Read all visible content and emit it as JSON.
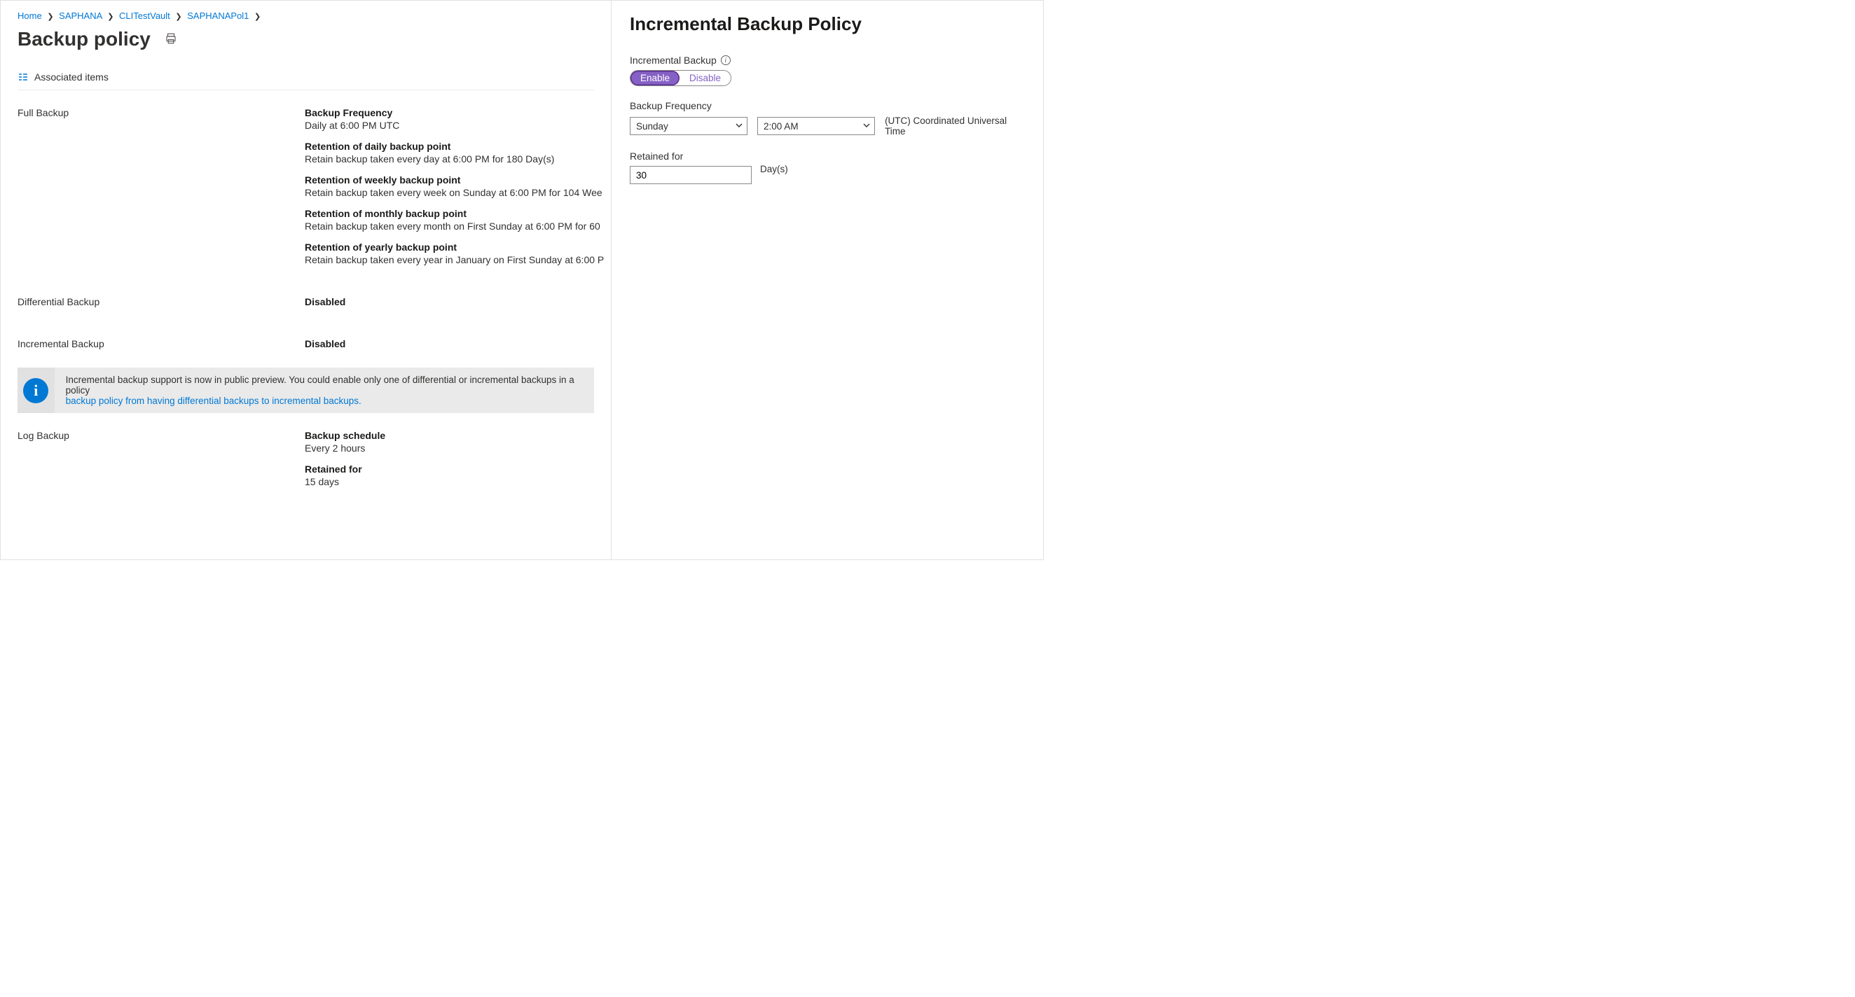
{
  "breadcrumb": {
    "items": [
      {
        "label": "Home"
      },
      {
        "label": "SAPHANA"
      },
      {
        "label": "CLITestVault"
      },
      {
        "label": "SAPHANAPol1"
      }
    ]
  },
  "page_title": "Backup policy",
  "toolbar": {
    "associated_items": "Associated items"
  },
  "sections": {
    "full_backup": {
      "label": "Full Backup",
      "freq_label": "Backup Frequency",
      "freq_value": "Daily at 6:00 PM UTC",
      "daily_label": "Retention of daily backup point",
      "daily_value": "Retain backup taken every day at 6:00 PM for 180 Day(s)",
      "weekly_label": "Retention of weekly backup point",
      "weekly_value": "Retain backup taken every week on Sunday at 6:00 PM for 104 Wee",
      "monthly_label": "Retention of monthly backup point",
      "monthly_value": "Retain backup taken every month on First Sunday at 6:00 PM for 60",
      "yearly_label": "Retention of yearly backup point",
      "yearly_value": "Retain backup taken every year in January on First Sunday at 6:00 P"
    },
    "differential": {
      "label": "Differential Backup",
      "status": "Disabled"
    },
    "incremental": {
      "label": "Incremental Backup",
      "status": "Disabled"
    },
    "log": {
      "label": "Log Backup",
      "schedule_label": "Backup schedule",
      "schedule_value": "Every 2 hours",
      "retained_label": "Retained for",
      "retained_value": "15 days"
    }
  },
  "banner": {
    "text_a": "Incremental backup support is now in public preview. You could enable only one of differential or incremental backups in a policy",
    "link": "backup policy from having differential backups to incremental backups."
  },
  "side": {
    "title": "Incremental Backup Policy",
    "toggle_label": "Incremental Backup",
    "enable": "Enable",
    "disable": "Disable",
    "freq_label": "Backup Frequency",
    "day_value": "Sunday",
    "time_value": "2:00 AM",
    "timezone": "(UTC) Coordinated Universal Time",
    "retained_label": "Retained for",
    "retained_value": "30",
    "retained_unit": "Day(s)"
  }
}
